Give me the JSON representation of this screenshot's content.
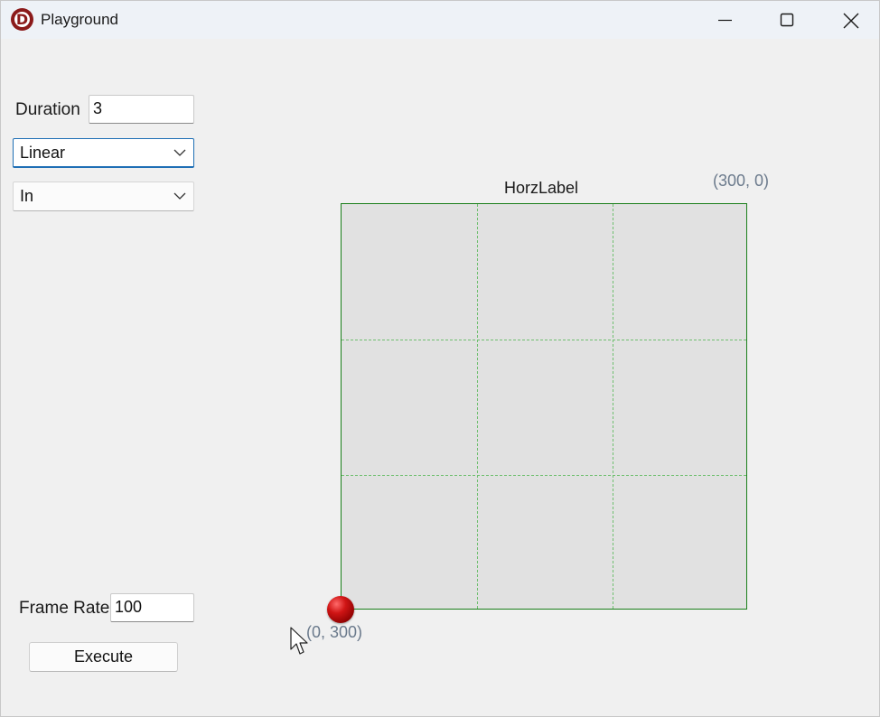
{
  "window": {
    "title": "Playground",
    "app_icon_letter": "D"
  },
  "controls": {
    "duration_label": "Duration",
    "duration_value": "3",
    "easing_select": "Linear",
    "mode_select": "In",
    "frame_rate_label": "Frame Rate",
    "frame_rate_value": "100",
    "execute_label": "Execute"
  },
  "plot": {
    "horz_label": "HorzLabel",
    "top_right_coord": "(300, 0)",
    "bottom_left_coord": "(0, 300)",
    "border_color": "#1a7f1a",
    "grid_color": "#6fbf6f",
    "fill_color": "#e1e1e1",
    "ball_color": "#d01515"
  },
  "icons": [
    "app-icon",
    "minimize-icon",
    "maximize-icon",
    "close-icon",
    "chevron-down-icon",
    "mouse-cursor-icon"
  ]
}
